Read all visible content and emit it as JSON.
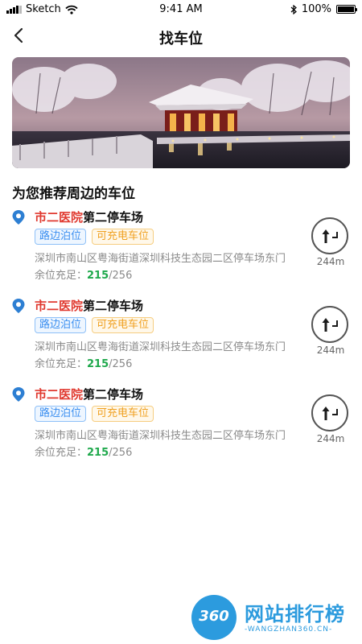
{
  "status_bar": {
    "carrier": "Sketch",
    "time": "9:41 AM",
    "battery": "100%",
    "battery_level": 1.0
  },
  "nav": {
    "title": "找车位"
  },
  "section": {
    "title": "为您推荐周边的车位"
  },
  "parkings": [
    {
      "name_highlight": "市二医院",
      "name_rest": "第二停车场",
      "tags": [
        "路边泊位",
        "可充电车位"
      ],
      "address": "深圳市南山区粤海街道深圳科技生态园二区停车场东门",
      "avail_label": "余位充足：",
      "avail_free": "215",
      "avail_total": "/256",
      "distance": "244m"
    },
    {
      "name_highlight": "市二医院",
      "name_rest": "第二停车场",
      "tags": [
        "路边泊位",
        "可充电车位"
      ],
      "address": "深圳市南山区粤海街道深圳科技生态园二区停车场东门",
      "avail_label": "余位充足：",
      "avail_free": "215",
      "avail_total": "/256",
      "distance": "244m"
    },
    {
      "name_highlight": "市二医院",
      "name_rest": "第二停车场",
      "tags": [
        "路边泊位",
        "可充电车位"
      ],
      "address": "深圳市南山区粤海街道深圳科技生态园二区停车场东门",
      "avail_label": "余位充足：",
      "avail_free": "215",
      "avail_total": "/256",
      "distance": "244m"
    }
  ],
  "watermark": {
    "logo_number": "360",
    "text": "网站排行榜",
    "sub": "-WANGZHAN360.CN-"
  },
  "colors": {
    "highlight": "#e0392f",
    "free": "#1fa94c",
    "tag_blue": "#3a8ef0",
    "tag_orange": "#f0a020",
    "pin": "#2d7fd3",
    "watermark": "#2c9bde"
  },
  "icons": {
    "back": "chevron-left-icon",
    "pin": "location-pin-icon",
    "navigate": "turn-right-arrow-icon",
    "wifi": "wifi-icon",
    "bluetooth": "bluetooth-icon"
  }
}
